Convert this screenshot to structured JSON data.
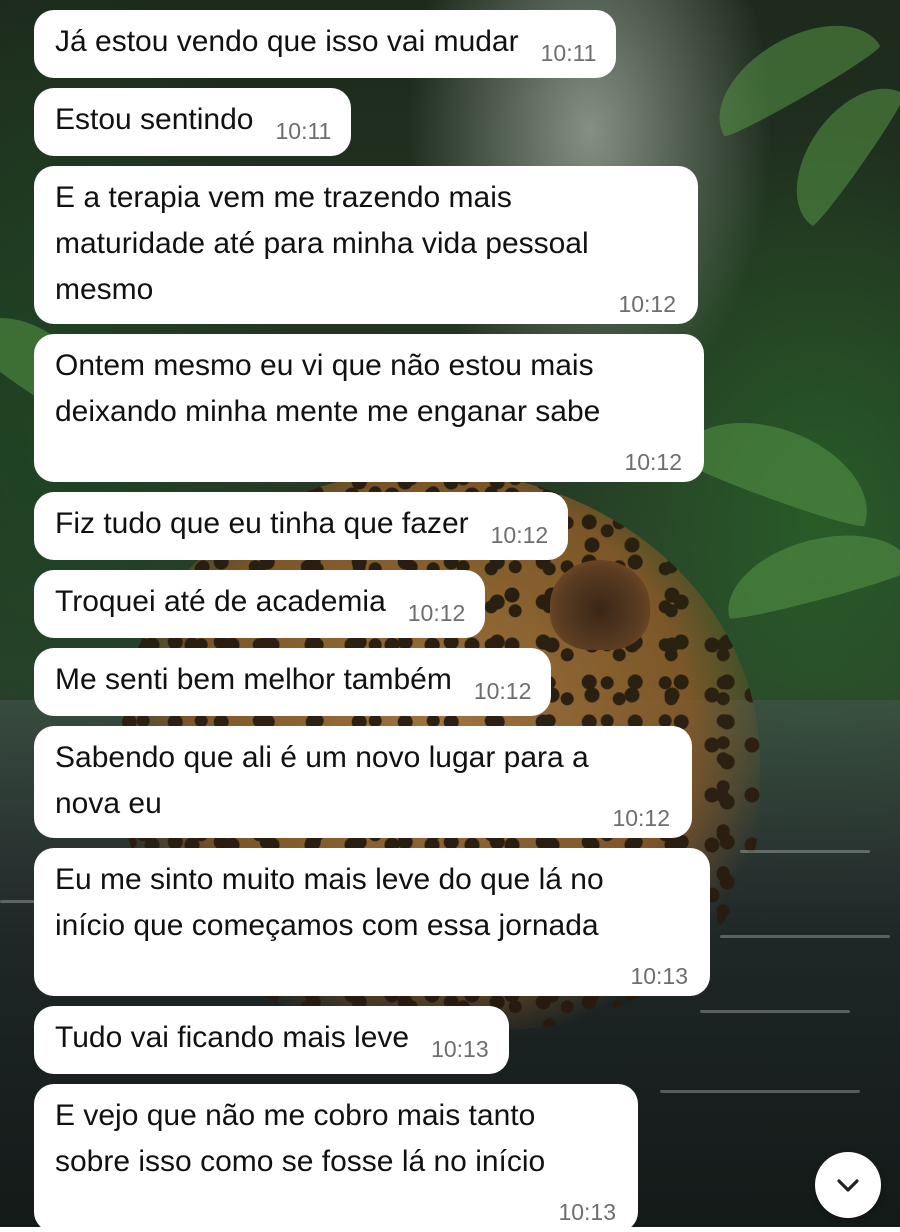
{
  "messages": [
    {
      "text": "Já estou vendo que isso vai mudar",
      "time": "10:11"
    },
    {
      "text": "Estou sentindo",
      "time": "10:11"
    },
    {
      "lines": [
        "E a terapia vem me trazendo mais",
        "maturidade até para minha vida pessoal",
        "mesmo"
      ],
      "time": "10:12"
    },
    {
      "lines": [
        "Ontem mesmo eu vi que não estou mais",
        "deixando minha mente me enganar sabe"
      ],
      "time": "10:12"
    },
    {
      "text": "Fiz tudo que eu tinha que fazer",
      "time": "10:12"
    },
    {
      "text": "Troquei até de academia",
      "time": "10:12"
    },
    {
      "text": "Me senti bem melhor também",
      "time": "10:12"
    },
    {
      "lines": [
        "Sabendo que ali é um novo lugar para a",
        "nova eu"
      ],
      "time": "10:12"
    },
    {
      "lines": [
        "Eu me sinto muito mais leve do que lá no",
        "início que começamos com essa jornada"
      ],
      "time": "10:13"
    },
    {
      "text": "Tudo vai ficando mais leve",
      "time": "10:13"
    },
    {
      "lines": [
        "E vejo que não me cobro mais tanto",
        "sobre isso como se fosse lá no início"
      ],
      "time": "10:13"
    }
  ],
  "scroll_button": {
    "icon": "chevron-down-icon"
  },
  "wallpaper": {
    "subject": "leopard-in-jungle-river"
  },
  "colors": {
    "bubble": "#ffffff",
    "text": "#111111",
    "time": "#6e6e6e"
  }
}
